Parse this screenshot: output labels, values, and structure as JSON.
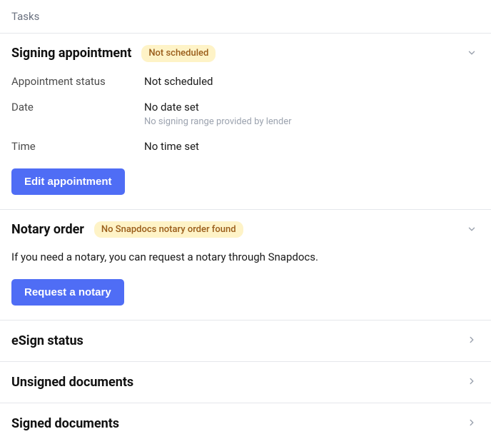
{
  "tasks_label": "Tasks",
  "signing": {
    "title": "Signing appointment",
    "badge": "Not scheduled",
    "rows": {
      "status_label": "Appointment status",
      "status_value": "Not scheduled",
      "date_label": "Date",
      "date_value": "No date set",
      "date_note": "No signing range provided by lender",
      "time_label": "Time",
      "time_value": "No time set"
    },
    "edit_button": "Edit appointment"
  },
  "notary": {
    "title": "Notary order",
    "badge": "No Snapdocs notary order found",
    "info": "If you need a notary, you can request a notary through Snapdocs.",
    "request_button": "Request a notary"
  },
  "esign": {
    "title": "eSign status"
  },
  "unsigned": {
    "title": "Unsigned documents"
  },
  "signed": {
    "title": "Signed documents"
  }
}
